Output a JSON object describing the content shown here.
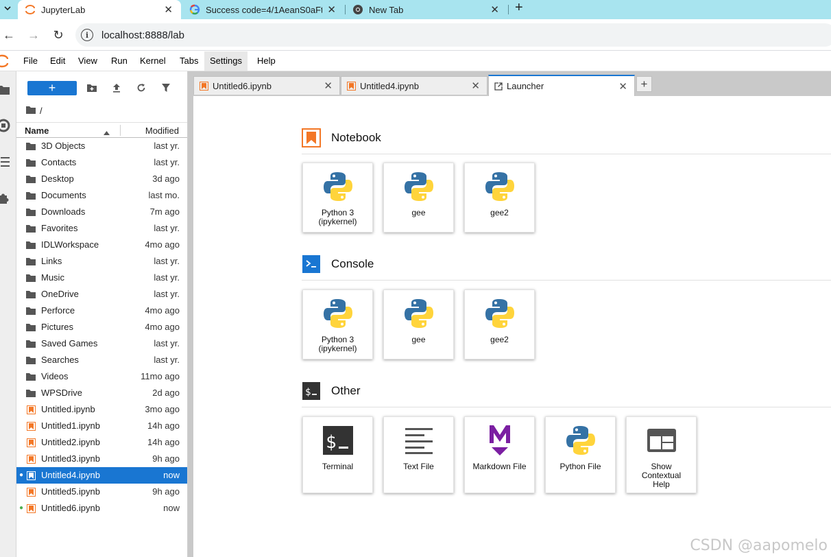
{
  "browser": {
    "tabs": [
      {
        "title": "JupyterLab"
      },
      {
        "title": "Success code=4/1AeanS0aFt"
      },
      {
        "title": "New Tab"
      }
    ],
    "url": "localhost:8888/lab"
  },
  "menubar": {
    "items": [
      "File",
      "Edit",
      "View",
      "Run",
      "Kernel",
      "Tabs",
      "Settings",
      "Help"
    ]
  },
  "filebrowser": {
    "new_button": "+",
    "breadcrumb": "/",
    "columns": {
      "name": "Name",
      "modified": "Modified"
    },
    "files": [
      {
        "name": "3D Objects",
        "modified": "last yr.",
        "type": "folder"
      },
      {
        "name": "Contacts",
        "modified": "last yr.",
        "type": "folder"
      },
      {
        "name": "Desktop",
        "modified": "3d ago",
        "type": "folder"
      },
      {
        "name": "Documents",
        "modified": "last mo.",
        "type": "folder"
      },
      {
        "name": "Downloads",
        "modified": "7m ago",
        "type": "folder"
      },
      {
        "name": "Favorites",
        "modified": "last yr.",
        "type": "folder"
      },
      {
        "name": "IDLWorkspace",
        "modified": "4mo ago",
        "type": "folder"
      },
      {
        "name": "Links",
        "modified": "last yr.",
        "type": "folder"
      },
      {
        "name": "Music",
        "modified": "last yr.",
        "type": "folder"
      },
      {
        "name": "OneDrive",
        "modified": "last yr.",
        "type": "folder"
      },
      {
        "name": "Perforce",
        "modified": "4mo ago",
        "type": "folder"
      },
      {
        "name": "Pictures",
        "modified": "4mo ago",
        "type": "folder"
      },
      {
        "name": "Saved Games",
        "modified": "last yr.",
        "type": "folder"
      },
      {
        "name": "Searches",
        "modified": "last yr.",
        "type": "folder"
      },
      {
        "name": "Videos",
        "modified": "11mo ago",
        "type": "folder"
      },
      {
        "name": "WPSDrive",
        "modified": "2d ago",
        "type": "folder"
      },
      {
        "name": "Untitled.ipynb",
        "modified": "3mo ago",
        "type": "notebook"
      },
      {
        "name": "Untitled1.ipynb",
        "modified": "14h ago",
        "type": "notebook"
      },
      {
        "name": "Untitled2.ipynb",
        "modified": "14h ago",
        "type": "notebook"
      },
      {
        "name": "Untitled3.ipynb",
        "modified": "9h ago",
        "type": "notebook"
      },
      {
        "name": "Untitled4.ipynb",
        "modified": "now",
        "type": "notebook",
        "selected": true,
        "running": true
      },
      {
        "name": "Untitled5.ipynb",
        "modified": "9h ago",
        "type": "notebook"
      },
      {
        "name": "Untitled6.ipynb",
        "modified": "now",
        "type": "notebook",
        "running": true
      }
    ]
  },
  "dock_tabs": [
    {
      "title": "Untitled6.ipynb",
      "icon": "notebook-icon"
    },
    {
      "title": "Untitled4.ipynb",
      "icon": "notebook-icon"
    },
    {
      "title": "Launcher",
      "icon": "launcher-icon",
      "active": true
    }
  ],
  "launcher": {
    "sections": [
      {
        "title": "Notebook",
        "icon": "notebook-section-icon",
        "cards": [
          {
            "label": "Python 3 (ipykernel)",
            "icon": "python-icon"
          },
          {
            "label": "gee",
            "icon": "python-icon"
          },
          {
            "label": "gee2",
            "icon": "python-icon"
          }
        ]
      },
      {
        "title": "Console",
        "icon": "console-section-icon",
        "cards": [
          {
            "label": "Python 3 (ipykernel)",
            "icon": "python-icon"
          },
          {
            "label": "gee",
            "icon": "python-icon"
          },
          {
            "label": "gee2",
            "icon": "python-icon"
          }
        ]
      },
      {
        "title": "Other",
        "icon": "terminal-section-icon",
        "cards": [
          {
            "label": "Terminal",
            "icon": "terminal-icon"
          },
          {
            "label": "Text File",
            "icon": "text-file-icon"
          },
          {
            "label": "Markdown File",
            "icon": "markdown-icon"
          },
          {
            "label": "Python File",
            "icon": "python-icon"
          },
          {
            "label": "Show Contextual Help",
            "icon": "help-icon"
          }
        ]
      }
    ]
  },
  "watermark": "CSDN @aapomelo",
  "colors": {
    "browser_tabstrip": "#a8e4ef",
    "accent_blue": "#1976d2",
    "notebook_orange": "#f37726",
    "markdown_purple": "#7b1fa2"
  }
}
